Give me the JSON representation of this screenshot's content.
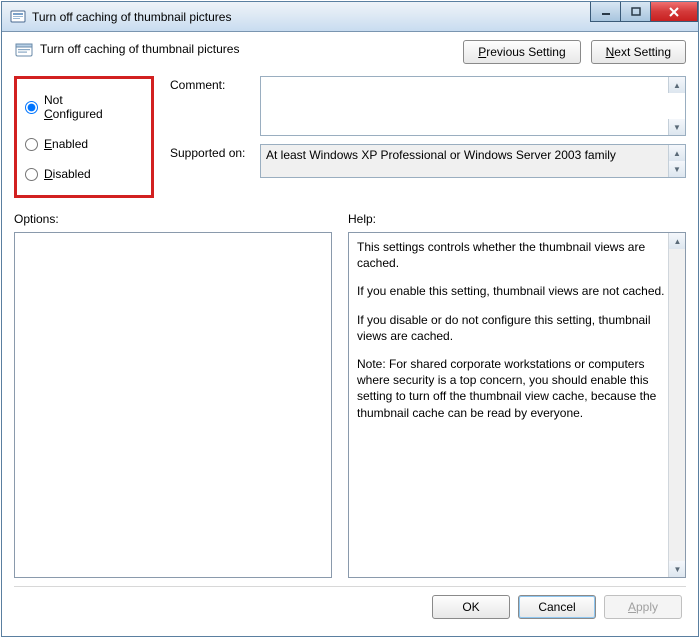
{
  "window": {
    "title": "Turn off caching of thumbnail pictures"
  },
  "header": {
    "policy_title": "Turn off caching of thumbnail pictures",
    "previous_setting": "Previous Setting",
    "next_setting": "Next Setting"
  },
  "state": {
    "not_configured": "Not Configured",
    "enabled": "Enabled",
    "disabled": "Disabled",
    "selected": "not_configured"
  },
  "fields": {
    "comment_label": "Comment:",
    "comment_value": "",
    "supported_label": "Supported on:",
    "supported_value": "At least Windows XP Professional or Windows Server 2003 family"
  },
  "options": {
    "label": "Options:"
  },
  "help": {
    "label": "Help:",
    "paragraphs": [
      "This settings controls whether the thumbnail views are cached.",
      "If you enable this setting, thumbnail views are not cached.",
      "If you disable or do not configure this setting, thumbnail views are cached.",
      "Note: For shared corporate workstations or computers where security is a top concern, you should enable this setting to turn off the thumbnail view cache, because the thumbnail cache can be read by everyone."
    ]
  },
  "footer": {
    "ok": "OK",
    "cancel": "Cancel",
    "apply": "Apply"
  }
}
